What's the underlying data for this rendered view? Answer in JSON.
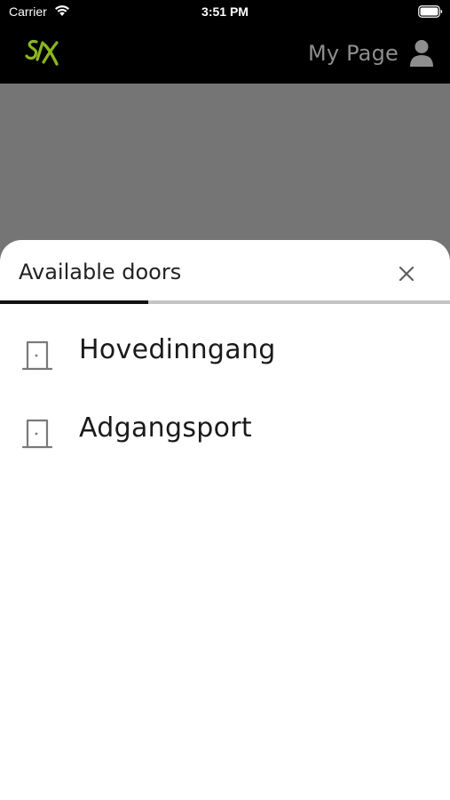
{
  "status_bar": {
    "carrier": "Carrier",
    "time": "3:51 PM"
  },
  "header": {
    "logo_icon": "six-logo-icon",
    "my_page_label": "My Page",
    "user_icon": "user-icon"
  },
  "sheet": {
    "title": "Available doors",
    "close_icon": "close-icon",
    "progress_fraction": 0.33,
    "doors": [
      {
        "label": "Hovedinngang",
        "icon": "door-icon"
      },
      {
        "label": "Adgangsport",
        "icon": "door-icon"
      }
    ]
  },
  "colors": {
    "header_bg": "#000000",
    "backdrop": "#757575",
    "logo_green": "#8ab61f",
    "muted_text": "#8e8e8e",
    "progress_track": "#c4c4c4",
    "progress_fill": "#111111"
  }
}
